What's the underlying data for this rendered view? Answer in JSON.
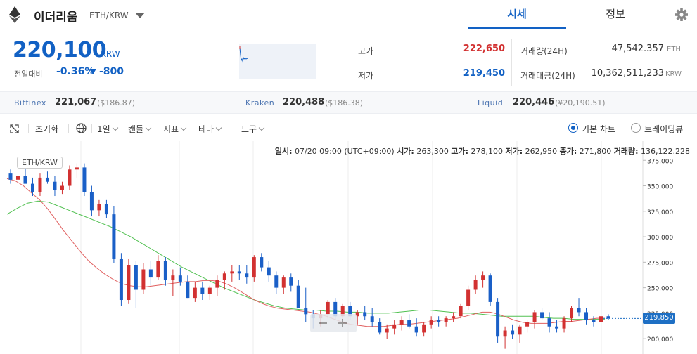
{
  "coin": {
    "name": "이더리움",
    "pair": "ETH/KRW"
  },
  "tabs": {
    "active": "시세",
    "info": "정보"
  },
  "price": {
    "value": "220,100",
    "unit": "KRW",
    "change_label": "전일대비",
    "change_pct": "-0.36%",
    "change_amt": "-800"
  },
  "stats": {
    "high_label": "고가",
    "high": "222,650",
    "low_label": "저가",
    "low": "219,450",
    "vol_label": "거래량(24H)",
    "vol": "47,542.357",
    "vol_unit": "ETH",
    "amt_label": "거래대금(24H)",
    "amt": "10,362,511,233",
    "amt_unit": "KRW"
  },
  "exchanges": [
    {
      "name": "Bitfinex",
      "price": "221,067",
      "sub": "($186.87)"
    },
    {
      "name": "Kraken",
      "price": "220,488",
      "sub": "($186.38)"
    },
    {
      "name": "Liquid",
      "price": "220,446",
      "sub": "(¥20,190.51)"
    }
  ],
  "toolbar": {
    "reset": "초기화",
    "interval": "1일",
    "candle": "캔들",
    "indicator": "지표",
    "theme": "테마",
    "tools": "도구",
    "basic_chart": "기본 차트",
    "tradingview": "트레이딩뷰"
  },
  "ohlc": {
    "date_label": "일시:",
    "date": "07/20 09:00 (UTC+09:00)",
    "open_label": "시가:",
    "open": "263,300",
    "high_label": "고가:",
    "high": "278,100",
    "low_label": "저가:",
    "low": "262,950",
    "close_label": "종가:",
    "close": "271,800",
    "vol_label": "거래량:",
    "vol": "136,122.228"
  },
  "chart_data": {
    "type": "candlestick",
    "title": "ETH/KRW",
    "ylim": [
      187000,
      380000
    ],
    "y_ticks": [
      "375,000",
      "350,000",
      "325,000",
      "300,000",
      "275,000",
      "250,000",
      "225,000",
      "200,000"
    ],
    "y_tick_values": [
      375000,
      350000,
      325000,
      300000,
      275000,
      250000,
      225000,
      200000
    ],
    "current": 219850,
    "current_label": "219,850",
    "colors": {
      "up": "#d23131",
      "down": "#1a5fc7",
      "ma_short": "#e06060",
      "ma_long": "#52c152"
    },
    "candles": [
      [
        362000,
        366000,
        352000,
        356000
      ],
      [
        356000,
        362000,
        350000,
        360000
      ],
      [
        360000,
        368000,
        355000,
        352000
      ],
      [
        352000,
        358000,
        340000,
        344000
      ],
      [
        344000,
        362000,
        340000,
        358000
      ],
      [
        358000,
        364000,
        352000,
        354000
      ],
      [
        354000,
        360000,
        340000,
        346000
      ],
      [
        346000,
        354000,
        342000,
        350000
      ],
      [
        350000,
        370000,
        346000,
        366000
      ],
      [
        366000,
        372000,
        358000,
        368000
      ],
      [
        368000,
        372000,
        340000,
        344000
      ],
      [
        344000,
        350000,
        320000,
        326000
      ],
      [
        326000,
        336000,
        320000,
        332000
      ],
      [
        332000,
        336000,
        318000,
        322000
      ],
      [
        322000,
        330000,
        274000,
        278000
      ],
      [
        278000,
        284000,
        232000,
        238000
      ],
      [
        238000,
        278000,
        234000,
        272000
      ],
      [
        272000,
        276000,
        230000,
        248000
      ],
      [
        248000,
        274000,
        244000,
        268000
      ],
      [
        268000,
        276000,
        252000,
        260000
      ],
      [
        260000,
        282000,
        258000,
        276000
      ],
      [
        276000,
        280000,
        252000,
        258000
      ],
      [
        258000,
        268000,
        242000,
        262000
      ],
      [
        262000,
        270000,
        252000,
        256000
      ],
      [
        256000,
        262000,
        240000,
        240000
      ],
      [
        240000,
        256000,
        236000,
        250000
      ],
      [
        250000,
        256000,
        238000,
        244000
      ],
      [
        244000,
        252000,
        238000,
        250000
      ],
      [
        250000,
        262000,
        242000,
        258000
      ],
      [
        258000,
        266000,
        248000,
        264000
      ],
      [
        264000,
        272000,
        256000,
        266000
      ],
      [
        266000,
        272000,
        258000,
        264000
      ],
      [
        264000,
        272000,
        254000,
        260000
      ],
      [
        260000,
        282000,
        256000,
        280000
      ],
      [
        280000,
        284000,
        266000,
        270000
      ],
      [
        270000,
        276000,
        256000,
        262000
      ],
      [
        262000,
        266000,
        244000,
        250000
      ],
      [
        250000,
        262000,
        244000,
        260000
      ],
      [
        260000,
        264000,
        246000,
        252000
      ],
      [
        252000,
        258000,
        240000,
        230000
      ],
      [
        230000,
        250000,
        216000,
        224000
      ],
      [
        224000,
        228000,
        210000,
        220000
      ],
      [
        220000,
        228000,
        212000,
        224000
      ],
      [
        224000,
        238000,
        220000,
        236000
      ],
      [
        236000,
        240000,
        218000,
        222000
      ],
      [
        222000,
        234000,
        218000,
        232000
      ],
      [
        232000,
        236000,
        218000,
        222000
      ],
      [
        222000,
        228000,
        214000,
        226000
      ],
      [
        226000,
        232000,
        218000,
        222000
      ],
      [
        222000,
        230000,
        212000,
        216000
      ],
      [
        216000,
        220000,
        204000,
        206000
      ],
      [
        206000,
        214000,
        200000,
        210000
      ],
      [
        210000,
        218000,
        204000,
        214000
      ],
      [
        214000,
        222000,
        208000,
        218000
      ],
      [
        218000,
        224000,
        210000,
        212000
      ],
      [
        212000,
        220000,
        202000,
        206000
      ],
      [
        206000,
        216000,
        202000,
        214000
      ],
      [
        214000,
        222000,
        210000,
        218000
      ],
      [
        218000,
        222000,
        212000,
        216000
      ],
      [
        216000,
        222000,
        212000,
        220000
      ],
      [
        220000,
        226000,
        216000,
        222000
      ],
      [
        222000,
        234000,
        220000,
        232000
      ],
      [
        232000,
        252000,
        228000,
        248000
      ],
      [
        248000,
        262000,
        244000,
        258000
      ],
      [
        258000,
        266000,
        250000,
        262000
      ],
      [
        262000,
        264000,
        232000,
        236000
      ],
      [
        236000,
        240000,
        196000,
        202000
      ],
      [
        202000,
        212000,
        190000,
        208000
      ],
      [
        208000,
        214000,
        200000,
        204000
      ],
      [
        204000,
        214000,
        196000,
        212000
      ],
      [
        212000,
        218000,
        206000,
        216000
      ],
      [
        216000,
        228000,
        210000,
        226000
      ],
      [
        226000,
        230000,
        218000,
        220000
      ],
      [
        220000,
        226000,
        206000,
        212000
      ],
      [
        212000,
        218000,
        206000,
        210000
      ],
      [
        210000,
        222000,
        206000,
        220000
      ],
      [
        220000,
        232000,
        216000,
        230000
      ],
      [
        230000,
        240000,
        222000,
        226000
      ],
      [
        226000,
        230000,
        214000,
        218000
      ],
      [
        218000,
        222000,
        212000,
        216000
      ],
      [
        216000,
        224000,
        214000,
        222000
      ],
      [
        222000,
        224000,
        218000,
        219850
      ]
    ],
    "ma_short": [
      357000,
      355000,
      350000,
      343000,
      336000,
      327000,
      316000,
      305000,
      295000,
      285000,
      276000,
      269000,
      263000,
      258000,
      254000,
      252000,
      251000,
      251000,
      252000,
      253000,
      254000,
      255000,
      256000,
      256000,
      257000,
      257000,
      256000,
      253000,
      249000,
      244000,
      239000,
      235000,
      232000,
      230000,
      229000,
      228000,
      227000,
      226000,
      224000,
      222000,
      219000,
      216000,
      214000,
      213000,
      212000,
      212000,
      212000,
      213000,
      214000,
      214000,
      215000,
      216000,
      217000,
      218000,
      219000,
      220000,
      222000,
      224000,
      226000,
      226000,
      224000,
      221000,
      218000,
      216000,
      215000,
      215000,
      215000,
      216000,
      217000,
      217000,
      218000,
      219000,
      220000,
      220000
    ],
    "ma_long": [
      322000,
      328000,
      333000,
      335000,
      334000,
      330000,
      326000,
      322000,
      318000,
      314000,
      310000,
      305000,
      300000,
      294000,
      288000,
      282000,
      276000,
      270000,
      265000,
      260000,
      255000,
      250000,
      246000,
      242000,
      238000,
      235000,
      232000,
      230000,
      229000,
      228000,
      228000,
      227000,
      227000,
      226000,
      226000,
      225000,
      225000,
      225000,
      226000,
      227000,
      228000,
      228000,
      227000,
      226000,
      225000,
      225000,
      224000,
      223000,
      222000,
      222000,
      222000,
      222000,
      221000,
      220000,
      220000,
      219000,
      219000,
      219000,
      219000
    ]
  }
}
